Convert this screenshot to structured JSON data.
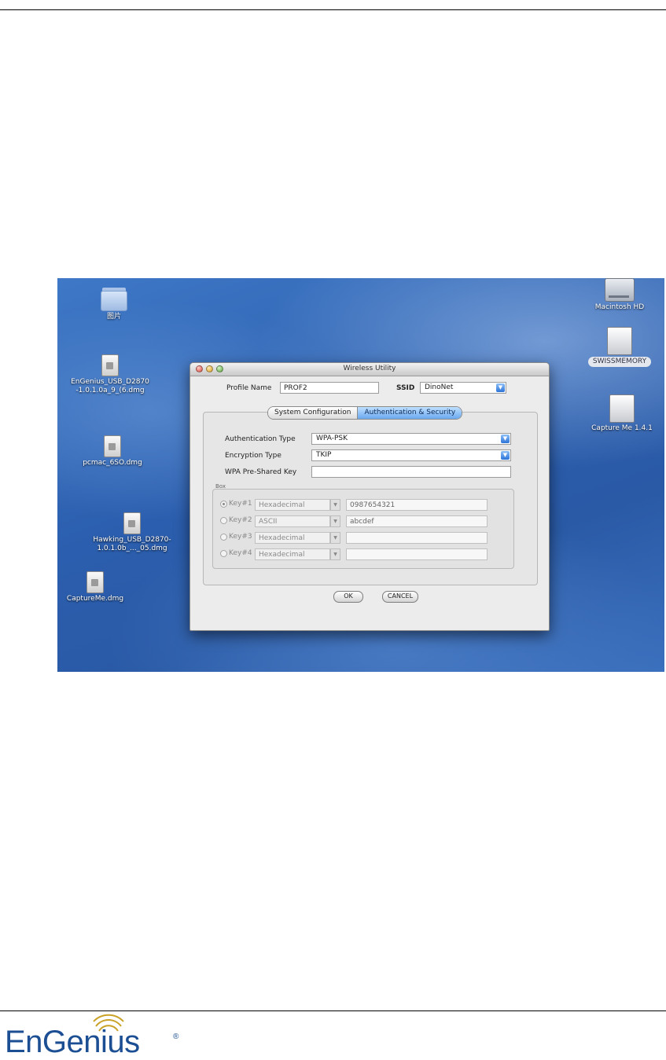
{
  "desktop": {
    "icons_left": [
      {
        "name": "folder",
        "label": "图片"
      },
      {
        "name": "dmg",
        "label": "EnGenius_USB_D2870-1.0.1.0a_9_(6.dmg"
      },
      {
        "name": "dmg",
        "label": "pcmac_6SO.dmg"
      },
      {
        "name": "dmg",
        "label": "Hawking_USB_D2870-1.0.1.0b_..._05.dmg"
      },
      {
        "name": "dmg",
        "label": "CaptureMe.dmg"
      }
    ],
    "icons_right": [
      {
        "name": "hard-drive",
        "label": "Macintosh HD"
      },
      {
        "name": "usb-drive",
        "label": "SWISSMEMORY"
      },
      {
        "name": "usb-drive",
        "label": "Capture Me 1.4.1"
      }
    ]
  },
  "window": {
    "title": "Wireless Utility",
    "profile_name_label": "Profile Name",
    "profile_name_value": "PROF2",
    "ssid_label": "SSID",
    "ssid_value": "DinoNet",
    "tabs": [
      {
        "label": "System Configuration",
        "active": false
      },
      {
        "label": "Authentication & Security",
        "active": true
      }
    ],
    "auth_type_label": "Authentication Type",
    "auth_type_value": "WPA-PSK",
    "enc_type_label": "Encryption Type",
    "enc_type_value": "TKIP",
    "psk_label": "WPA Pre-Shared Key",
    "psk_value": "",
    "group_title": "Box",
    "keys": [
      {
        "label": "Key#1",
        "type": "Hexadecimal",
        "value": "0987654321",
        "selected": true
      },
      {
        "label": "Key#2",
        "type": "ASCII",
        "value": "abcdef",
        "selected": false
      },
      {
        "label": "Key#3",
        "type": "Hexadecimal",
        "value": "",
        "selected": false
      },
      {
        "label": "Key#4",
        "type": "Hexadecimal",
        "value": "",
        "selected": false
      }
    ],
    "ok_label": "OK",
    "cancel_label": "CANCEL"
  },
  "footer": {
    "logo_text": "EnGenius",
    "logo_reg": "®",
    "brand_color": "#1b4e92"
  }
}
